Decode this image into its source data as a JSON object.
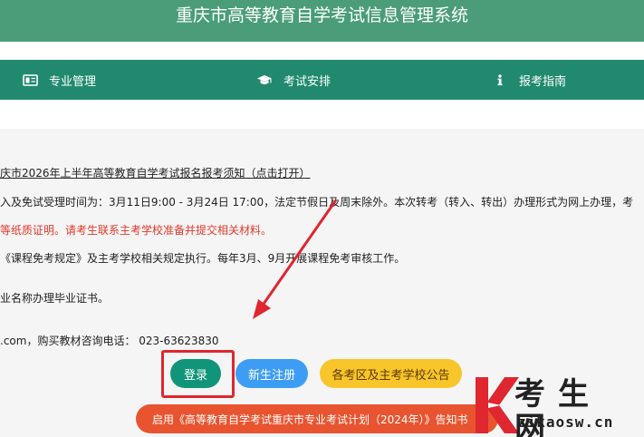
{
  "header": {
    "title": "重庆市高等教育自学考试信息管理系统"
  },
  "nav": {
    "items": [
      {
        "label": "专业管理",
        "icon": "id-card-icon"
      },
      {
        "label": "考试安排",
        "icon": "graduation-cap-icon"
      },
      {
        "label": "报考指南",
        "icon": "info-icon"
      }
    ]
  },
  "notice": {
    "lines": [
      "庆市2026年上半年高等教育自学考试报名报考须知（点击打开）",
      "入及免试受理时间为：3月11日9:00 - 3月24日 17:00，法定节假日及周末除外。本次转考（转入、转出）办理形式为网上办理，考",
      "等纸质证明。请考生联系主考学校准备并提交相关材料。",
      "《课程免考规定》及主考学校相关规定执行。每年3月、9月开展课程免考审核工作。",
      "业名称办理毕业证书。",
      ".com，购买教材咨询电话： 023-63623830"
    ]
  },
  "actions": {
    "login": "登录",
    "register": "新生注册",
    "notice": "各考区及主考学校公告"
  },
  "banner": {
    "text": "启用《高等教育自学考试重庆市专业考试计划（2024年）》告知书"
  },
  "watermark": {
    "name": "考生网",
    "url": "zikaosw.cn"
  },
  "colors": {
    "header": "#4a9d78",
    "nav": "#218a6e",
    "login": "#11957a",
    "register": "#3d9df5",
    "notice": "#f8c52a",
    "banner": "#e8542f",
    "highlight": "#e0262f"
  }
}
